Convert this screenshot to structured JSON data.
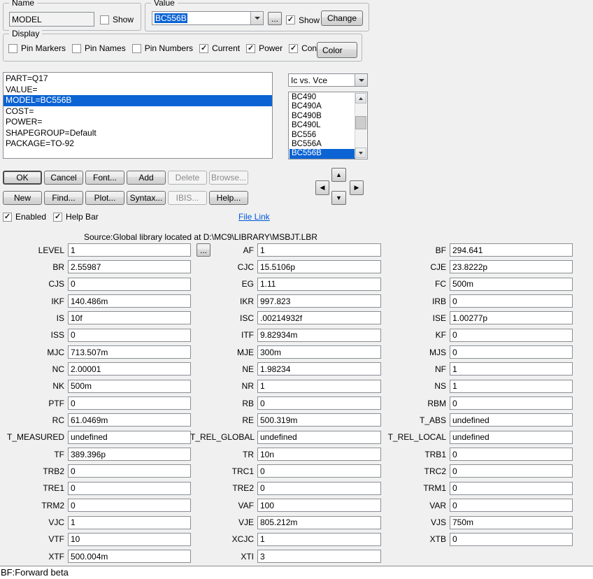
{
  "colors": {
    "selection": "#0c64d4",
    "link": "#0057d8"
  },
  "nav": {
    "up_glyph": "▲",
    "down_glyph": "▼",
    "left_glyph": "◀",
    "right_glyph": "▶"
  },
  "name_group": {
    "title": "Name",
    "field_value": "MODEL",
    "show_label": "Show",
    "show_checked": false
  },
  "value_group": {
    "title": "Value",
    "combo_value": "BC556B",
    "more_label": "...",
    "show_label": "Show",
    "show_checked": true,
    "change_label": "Change"
  },
  "display_group": {
    "title": "Display",
    "color_button_label": "Color",
    "checkboxes": [
      {
        "label": "Pin Markers",
        "checked": false
      },
      {
        "label": "Pin Names",
        "checked": false
      },
      {
        "label": "Pin Numbers",
        "checked": false
      },
      {
        "label": "Current",
        "checked": true
      },
      {
        "label": "Power",
        "checked": true
      },
      {
        "label": "Condition",
        "checked": true
      }
    ]
  },
  "attribute_list": {
    "items": [
      "PART=Q17",
      "VALUE=",
      "MODEL=BC556B",
      "COST=",
      "POWER=",
      "SHAPEGROUP=Default",
      "PACKAGE=TO-92"
    ],
    "selected_index": 2
  },
  "plot_combo": {
    "value": "Ic vs. Vce"
  },
  "model_list": {
    "items": [
      "BC490",
      "BC490A",
      "BC490B",
      "BC490L",
      "BC556",
      "BC556A",
      "BC556B"
    ],
    "selected_index": 6
  },
  "buttons": {
    "row1": [
      {
        "label": "OK",
        "enabled": true,
        "default": true
      },
      {
        "label": "Cancel",
        "enabled": true
      },
      {
        "label": "Font...",
        "enabled": true
      },
      {
        "label": "Add",
        "enabled": true
      },
      {
        "label": "Delete",
        "enabled": false
      },
      {
        "label": "Browse...",
        "enabled": false
      }
    ],
    "row2": [
      {
        "label": "New",
        "enabled": true
      },
      {
        "label": "Find...",
        "enabled": true
      },
      {
        "label": "Plot...",
        "enabled": true
      },
      {
        "label": "Syntax...",
        "enabled": true
      },
      {
        "label": "IBIS...",
        "enabled": false
      },
      {
        "label": "Help...",
        "enabled": true
      }
    ]
  },
  "toggles": [
    {
      "label": "Enabled",
      "checked": true
    },
    {
      "label": "Help Bar",
      "checked": true
    }
  ],
  "file_link_label": "File Link",
  "source_line": "Source:Global library located at D:\\MC9\\LIBRARY\\MSBJT.LBR",
  "parameters": {
    "level_more_label": "...",
    "columns": [
      {
        "rows": [
          [
            "LEVEL",
            "1"
          ],
          [
            "BR",
            "2.55987"
          ],
          [
            "CJS",
            "0"
          ],
          [
            "IKF",
            "140.486m"
          ],
          [
            "IS",
            "10f"
          ],
          [
            "ISS",
            "0"
          ],
          [
            "MJC",
            "713.507m"
          ],
          [
            "NC",
            "2.00001"
          ],
          [
            "NK",
            "500m"
          ],
          [
            "PTF",
            "0"
          ],
          [
            "RC",
            "61.0469m"
          ],
          [
            "T_MEASURED",
            "undefined"
          ],
          [
            "TF",
            "389.396p"
          ],
          [
            "TRB2",
            "0"
          ],
          [
            "TRE1",
            "0"
          ],
          [
            "TRM2",
            "0"
          ],
          [
            "VJC",
            "1"
          ],
          [
            "VTF",
            "10"
          ],
          [
            "XTF",
            "500.004m"
          ]
        ]
      },
      {
        "rows": [
          [
            "AF",
            "1"
          ],
          [
            "CJC",
            "15.5106p"
          ],
          [
            "EG",
            "1.11"
          ],
          [
            "IKR",
            "997.823"
          ],
          [
            "ISC",
            ".00214932f"
          ],
          [
            "ITF",
            "9.82934m"
          ],
          [
            "MJE",
            "300m"
          ],
          [
            "NE",
            "1.98234"
          ],
          [
            "NR",
            "1"
          ],
          [
            "RB",
            "0"
          ],
          [
            "RE",
            "500.319m"
          ],
          [
            "T_REL_GLOBAL",
            "undefined"
          ],
          [
            "TR",
            "10n"
          ],
          [
            "TRC1",
            "0"
          ],
          [
            "TRE2",
            "0"
          ],
          [
            "VAF",
            "100"
          ],
          [
            "VJE",
            "805.212m"
          ],
          [
            "XCJC",
            "1"
          ],
          [
            "XTI",
            "3"
          ]
        ]
      },
      {
        "rows": [
          [
            "BF",
            "294.641"
          ],
          [
            "CJE",
            "23.8222p"
          ],
          [
            "FC",
            "500m"
          ],
          [
            "IRB",
            "0"
          ],
          [
            "ISE",
            "1.00277p"
          ],
          [
            "KF",
            "0"
          ],
          [
            "MJS",
            "0"
          ],
          [
            "NF",
            "1"
          ],
          [
            "NS",
            "1"
          ],
          [
            "RBM",
            "0"
          ],
          [
            "T_ABS",
            "undefined"
          ],
          [
            "T_REL_LOCAL",
            "undefined"
          ],
          [
            "TRB1",
            "0"
          ],
          [
            "TRC2",
            "0"
          ],
          [
            "TRM1",
            "0"
          ],
          [
            "VAR",
            "0"
          ],
          [
            "VJS",
            "750m"
          ],
          [
            "XTB",
            "0"
          ]
        ]
      }
    ]
  },
  "status_bar": "BF:Forward beta"
}
